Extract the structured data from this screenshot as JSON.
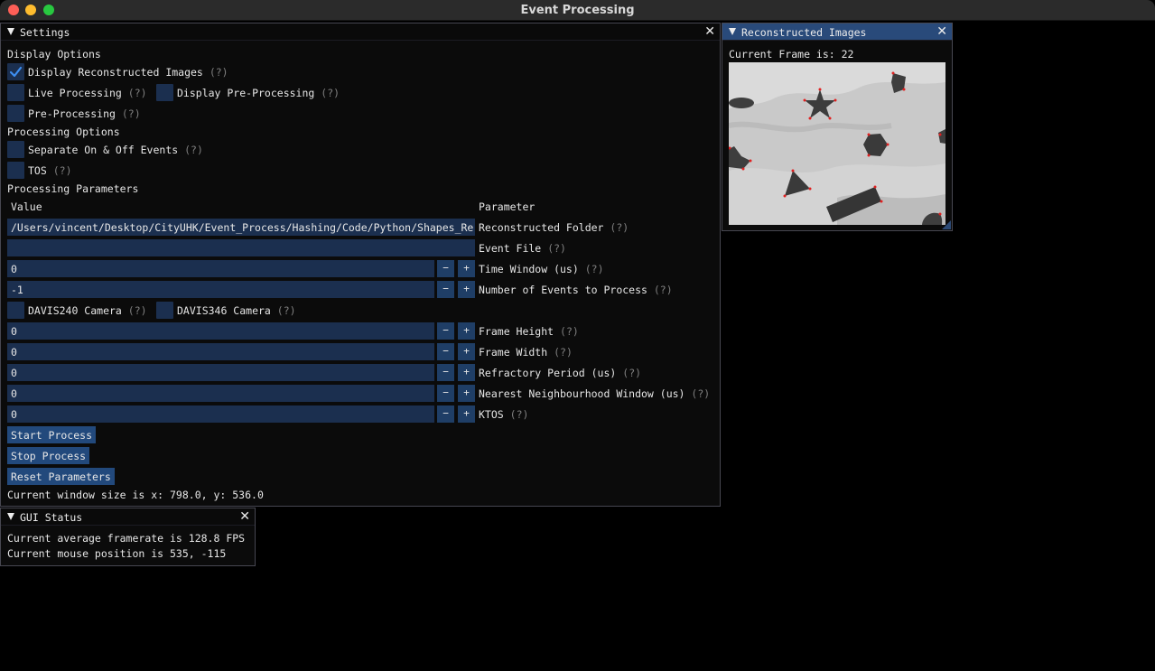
{
  "app": {
    "title": "Event Processing"
  },
  "settings": {
    "title": "Settings",
    "display_options_header": "Display Options",
    "display_reconstructed": {
      "label": "Display Reconstructed Images",
      "help": "(?)",
      "checked": true
    },
    "live_processing": {
      "label": "Live Processing",
      "help": "(?)",
      "checked": false
    },
    "display_preprocessing": {
      "label": "Display Pre-Processing",
      "help": "(?)",
      "checked": false
    },
    "preprocessing": {
      "label": "Pre-Processing",
      "help": "(?)",
      "checked": false
    },
    "processing_options_header": "Processing Options",
    "separate_events": {
      "label": "Separate On & Off Events",
      "help": "(?)",
      "checked": false
    },
    "tos": {
      "label": "TOS",
      "help": "(?)",
      "checked": false
    },
    "processing_parameters_header": "Processing Parameters",
    "col_value": "Value",
    "col_parameter": "Parameter",
    "reconstructed_folder": {
      "value": "/Users/vincent/Desktop/CityUHK/Event_Process/Hashing/Code/Python/Shapes_Re",
      "label": "Reconstructed Folder",
      "help": "(?)"
    },
    "event_file": {
      "value": "",
      "label": "Event File",
      "help": "(?)"
    },
    "time_window": {
      "value": "0",
      "label": "Time Window (us)",
      "help": "(?)"
    },
    "num_events": {
      "value": "-1",
      "label": "Number of Events to Process",
      "help": "(?)"
    },
    "davis240": {
      "label": "DAVIS240 Camera",
      "help": "(?)",
      "checked": false
    },
    "davis346": {
      "label": "DAVIS346 Camera",
      "help": "(?)",
      "checked": false
    },
    "frame_height": {
      "value": "0",
      "label": "Frame Height",
      "help": "(?)"
    },
    "frame_width": {
      "value": "0",
      "label": "Frame Width",
      "help": "(?)"
    },
    "refractory_period": {
      "value": "0",
      "label": "Refractory Period (us)",
      "help": "(?)"
    },
    "nearest_neighbourhood": {
      "value": "0",
      "label": "Nearest Neighbourhood Window (us)",
      "help": "(?)"
    },
    "ktos": {
      "value": "0",
      "label": "KTOS",
      "help": "(?)"
    },
    "minus": "−",
    "plus": "+",
    "start_button": "Start Process",
    "stop_button": "Stop Process",
    "reset_button": "Reset Parameters",
    "window_size_text": "Current window size is x: 798.0, y: 536.0"
  },
  "gui_status": {
    "title": "GUI Status",
    "framerate_text": "Current average framerate is 128.8 FPS",
    "mouse_text": "Current mouse position is 535, -115"
  },
  "reconstructed": {
    "title": "Reconstructed Images",
    "frame_text": "Current Frame is: 22"
  },
  "colors": {
    "frame_bg": "#1b2f4f",
    "button": "#22497c",
    "title_active": "#294a7a",
    "corner_marker": "#e02020"
  },
  "icons": {
    "close": "close-icon",
    "collapse": "triangle-down-icon",
    "check": "checkmark-icon"
  }
}
